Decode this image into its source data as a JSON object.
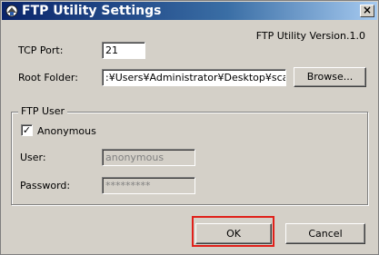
{
  "window": {
    "title": "FTP Utility Settings",
    "close_glyph": "×"
  },
  "version": "FTP Utility Version.1.0",
  "tcp_port": {
    "label": "TCP Port:",
    "value": "21"
  },
  "root_folder": {
    "label": "Root Folder:",
    "value": ":¥Users¥Administrator¥Desktop¥scan",
    "browse_label": "Browse..."
  },
  "ftp_user": {
    "group_title": "FTP User",
    "anonymous": {
      "label": "Anonymous",
      "checked": true,
      "check_glyph": "✓"
    },
    "user": {
      "label": "User:",
      "value": "anonymous"
    },
    "password": {
      "label": "Password:",
      "value": "*********"
    }
  },
  "buttons": {
    "ok": "OK",
    "cancel": "Cancel"
  },
  "colors": {
    "highlight": "#e0201a",
    "title_bar": "#0a246a"
  },
  "icons": {
    "app": "ftp-utility-icon"
  }
}
